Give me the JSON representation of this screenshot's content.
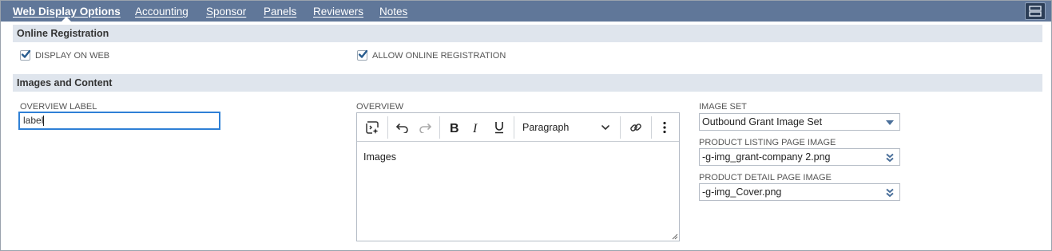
{
  "tabs": [
    {
      "label": "Web Display Options",
      "active": true
    },
    {
      "label": "Accounting",
      "active": false
    },
    {
      "label": "Sponsor",
      "active": false
    },
    {
      "label": "Panels",
      "active": false
    },
    {
      "label": "Reviewers",
      "active": false
    },
    {
      "label": "Notes",
      "active": false
    }
  ],
  "online_registration": {
    "title": "Online Registration",
    "display_on_web": {
      "label": "DISPLAY ON WEB",
      "checked": true
    },
    "allow_online_registration": {
      "label": "ALLOW ONLINE REGISTRATION",
      "checked": true
    }
  },
  "images_content": {
    "title": "Images and Content",
    "overview_label": {
      "label": "OVERVIEW LABEL",
      "value": "label"
    },
    "overview": {
      "label": "OVERVIEW",
      "format_value": "Paragraph",
      "body_text": "Images"
    },
    "image_set": {
      "label": "IMAGE SET",
      "value": "Outbound Grant Image Set"
    },
    "product_listing_image": {
      "label": "PRODUCT LISTING PAGE IMAGE",
      "value": "-g-img_grant-company 2.png"
    },
    "product_detail_image": {
      "label": "PRODUCT DETAIL PAGE IMAGE",
      "value": "-g-img_Cover.png"
    }
  },
  "colors": {
    "tabbar_bg": "#607799",
    "section_bg": "#dfe5ed",
    "checkbox_check": "#2a5d8f",
    "focus_border": "#2f80d6",
    "select_arrow": "#4a6f9a"
  },
  "icons": {
    "layout": "layout-rows-icon",
    "ai": "ai-assistant-icon",
    "undo": "undo-icon",
    "redo": "redo-icon",
    "bold": "bold-icon",
    "italic": "italic-icon",
    "underline": "underline-icon",
    "chevron": "chevron-down-icon",
    "link": "link-icon",
    "more": "more-vertical-icon"
  }
}
